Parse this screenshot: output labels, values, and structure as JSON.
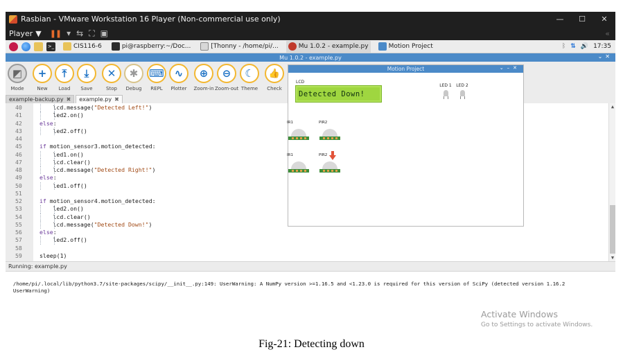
{
  "vm_window": {
    "title": "Rasbian - VMware Workstation 16 Player (Non-commercial use only)",
    "player_label": "Player",
    "controls": [
      "—",
      "☐",
      "✕"
    ]
  },
  "taskbar": {
    "tasks": [
      {
        "label": "CIS116-6",
        "color": "#e8c35a"
      },
      {
        "label": "pi@raspberry:~/Doc...",
        "color": "#2b2b2b"
      },
      {
        "label": "[Thonny - /home/pi/...",
        "color": "#d8d8d8"
      },
      {
        "label": "Mu 1.0.2 - example.py",
        "color": "#c0392b"
      },
      {
        "label": "Motion Project",
        "color": "#4b8ac8"
      }
    ],
    "clock": "17:35"
  },
  "mu_window": {
    "title": "Mu 1.0.2 - example.py",
    "toolbar": [
      {
        "label": "Mode",
        "glyph": "◩"
      },
      {
        "label": "New",
        "glyph": "+"
      },
      {
        "label": "Load",
        "glyph": "⤒"
      },
      {
        "label": "Save",
        "glyph": "⤓"
      },
      {
        "label": "Stop",
        "glyph": "✕"
      },
      {
        "label": "Debug",
        "glyph": "✱"
      },
      {
        "label": "REPL",
        "glyph": "⌨"
      },
      {
        "label": "Plotter",
        "glyph": "∿"
      },
      {
        "label": "Zoom-in",
        "glyph": "⊕"
      },
      {
        "label": "Zoom-out",
        "glyph": "⊖"
      },
      {
        "label": "Theme",
        "glyph": "☾"
      },
      {
        "label": "Check",
        "glyph": "👍"
      }
    ],
    "tabs": [
      {
        "label": "example-backup.py",
        "active": false
      },
      {
        "label": "example.py",
        "active": true
      }
    ],
    "code_lines": [
      {
        "num": "40",
        "indent": 2,
        "text": "lcd.message(\"Detected Left!\")"
      },
      {
        "num": "41",
        "indent": 2,
        "text": "led2.on()"
      },
      {
        "num": "42",
        "indent": 1,
        "text": "else:"
      },
      {
        "num": "43",
        "indent": 2,
        "text": "led2.off()"
      },
      {
        "num": "44",
        "indent": 0,
        "text": ""
      },
      {
        "num": "45",
        "indent": 1,
        "text": "if motion_sensor3.motion_detected:"
      },
      {
        "num": "46",
        "indent": 2,
        "text": "led1.on()"
      },
      {
        "num": "47",
        "indent": 2,
        "text": "lcd.clear()"
      },
      {
        "num": "48",
        "indent": 2,
        "text": "lcd.message(\"Detected Right!\")"
      },
      {
        "num": "49",
        "indent": 1,
        "text": "else:"
      },
      {
        "num": "50",
        "indent": 2,
        "text": "led1.off()"
      },
      {
        "num": "51",
        "indent": 0,
        "text": ""
      },
      {
        "num": "52",
        "indent": 1,
        "text": "if motion_sensor4.motion_detected:"
      },
      {
        "num": "53",
        "indent": 2,
        "text": "led2.on()"
      },
      {
        "num": "54",
        "indent": 2,
        "text": "lcd.clear()"
      },
      {
        "num": "55",
        "indent": 2,
        "text": "lcd.message(\"Detected Down!\")"
      },
      {
        "num": "56",
        "indent": 1,
        "text": "else:"
      },
      {
        "num": "57",
        "indent": 2,
        "text": "led2.off()"
      },
      {
        "num": "58",
        "indent": 0,
        "text": ""
      },
      {
        "num": "59",
        "indent": 1,
        "text": "sleep(1)"
      }
    ],
    "status": "Running: example.py",
    "console": "/home/pi/.local/lib/python3.7/site-packages/scipy/__init__.py:149: UserWarning: A NumPy version >=1.16.5 and <1.23.0 is required for this version of SciPy (detected version 1.16.2\n  UserWarning)"
  },
  "motion_window": {
    "title": "Motion Project",
    "lcd_label": "LCD",
    "lcd_text": "Detected Down!",
    "leds": [
      {
        "label": "LED 1",
        "on": false
      },
      {
        "label": "LED 2",
        "on": false
      }
    ],
    "sensors": [
      {
        "label": "IR1",
        "row": 0,
        "col": 0,
        "triggered": false
      },
      {
        "label": "PIR2",
        "row": 0,
        "col": 1,
        "triggered": false
      },
      {
        "label": "IR1",
        "row": 1,
        "col": 0,
        "triggered": false
      },
      {
        "label": "PIR2",
        "row": 1,
        "col": 1,
        "triggered": true
      }
    ]
  },
  "watermark": {
    "line1": "Activate Windows",
    "line2": "Go to Settings to activate Windows."
  },
  "caption": "Fig-21: Detecting down"
}
